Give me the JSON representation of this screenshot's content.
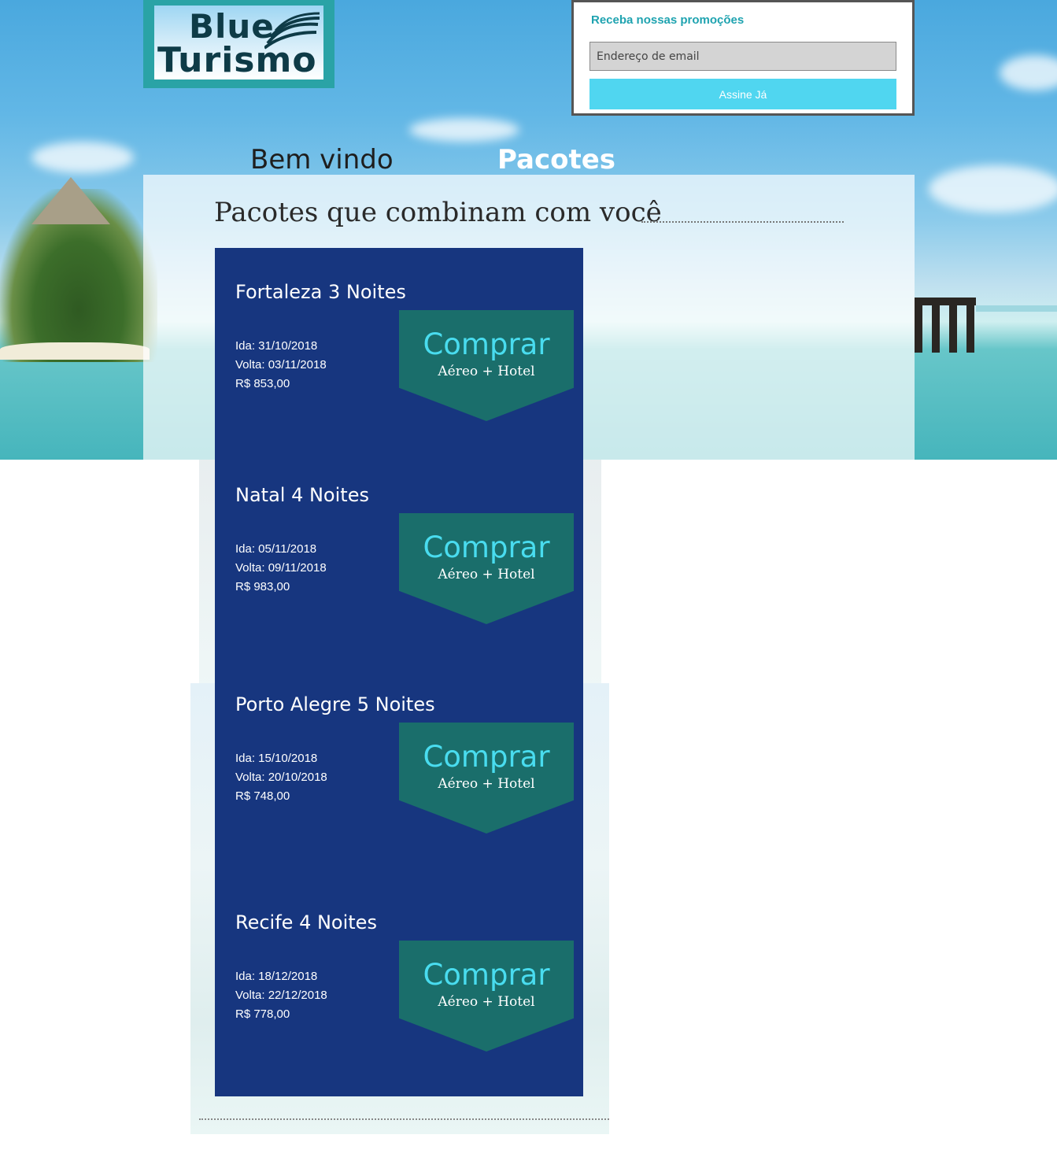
{
  "brand": {
    "logo_line1": "Blue",
    "logo_line2": "Turismo",
    "colors": {
      "logo_frame": "#2aa3a6",
      "logo_text": "#0e3b47"
    }
  },
  "newsletter": {
    "title": "Receba nossas promoções",
    "email_placeholder": "Endereço de email",
    "submit_label": "Assine Já",
    "colors": {
      "title": "#1fa3b0",
      "button": "#50d6f0"
    }
  },
  "nav": {
    "items": [
      {
        "label": "Bem vindo",
        "active": false
      },
      {
        "label": "Pacotes",
        "active": true
      }
    ]
  },
  "section": {
    "title": "Pacotes que combinam com você"
  },
  "packages": [
    {
      "name": "Fortaleza 3 Noites",
      "ida": "Ida: 31/10/2018",
      "volta": "Volta: 03/11/2018",
      "price": "R$ 853,00",
      "buy_label": "Comprar",
      "buy_sub": "Aéreo + Hotel"
    },
    {
      "name": "Natal 4 Noites",
      "ida": "Ida: 05/11/2018",
      "volta": "Volta: 09/11/2018",
      "price": "R$ 983,00",
      "buy_label": "Comprar",
      "buy_sub": "Aéreo + Hotel"
    },
    {
      "name": "Porto Alegre 5 Noites",
      "ida": "Ida: 15/10/2018",
      "volta": "Volta: 20/10/2018",
      "price": "R$ 748,00",
      "buy_label": "Comprar",
      "buy_sub": "Aéreo + Hotel"
    },
    {
      "name": "Recife 4 Noites",
      "ida": "Ida: 18/12/2018",
      "volta": "Volta: 22/12/2018",
      "price": "R$ 778,00",
      "buy_label": "Comprar",
      "buy_sub": "Aéreo + Hotel"
    }
  ],
  "colors": {
    "packages_bg": "#17367f",
    "buy_bg": "#1a6e6b",
    "buy_label": "#49dcef"
  }
}
